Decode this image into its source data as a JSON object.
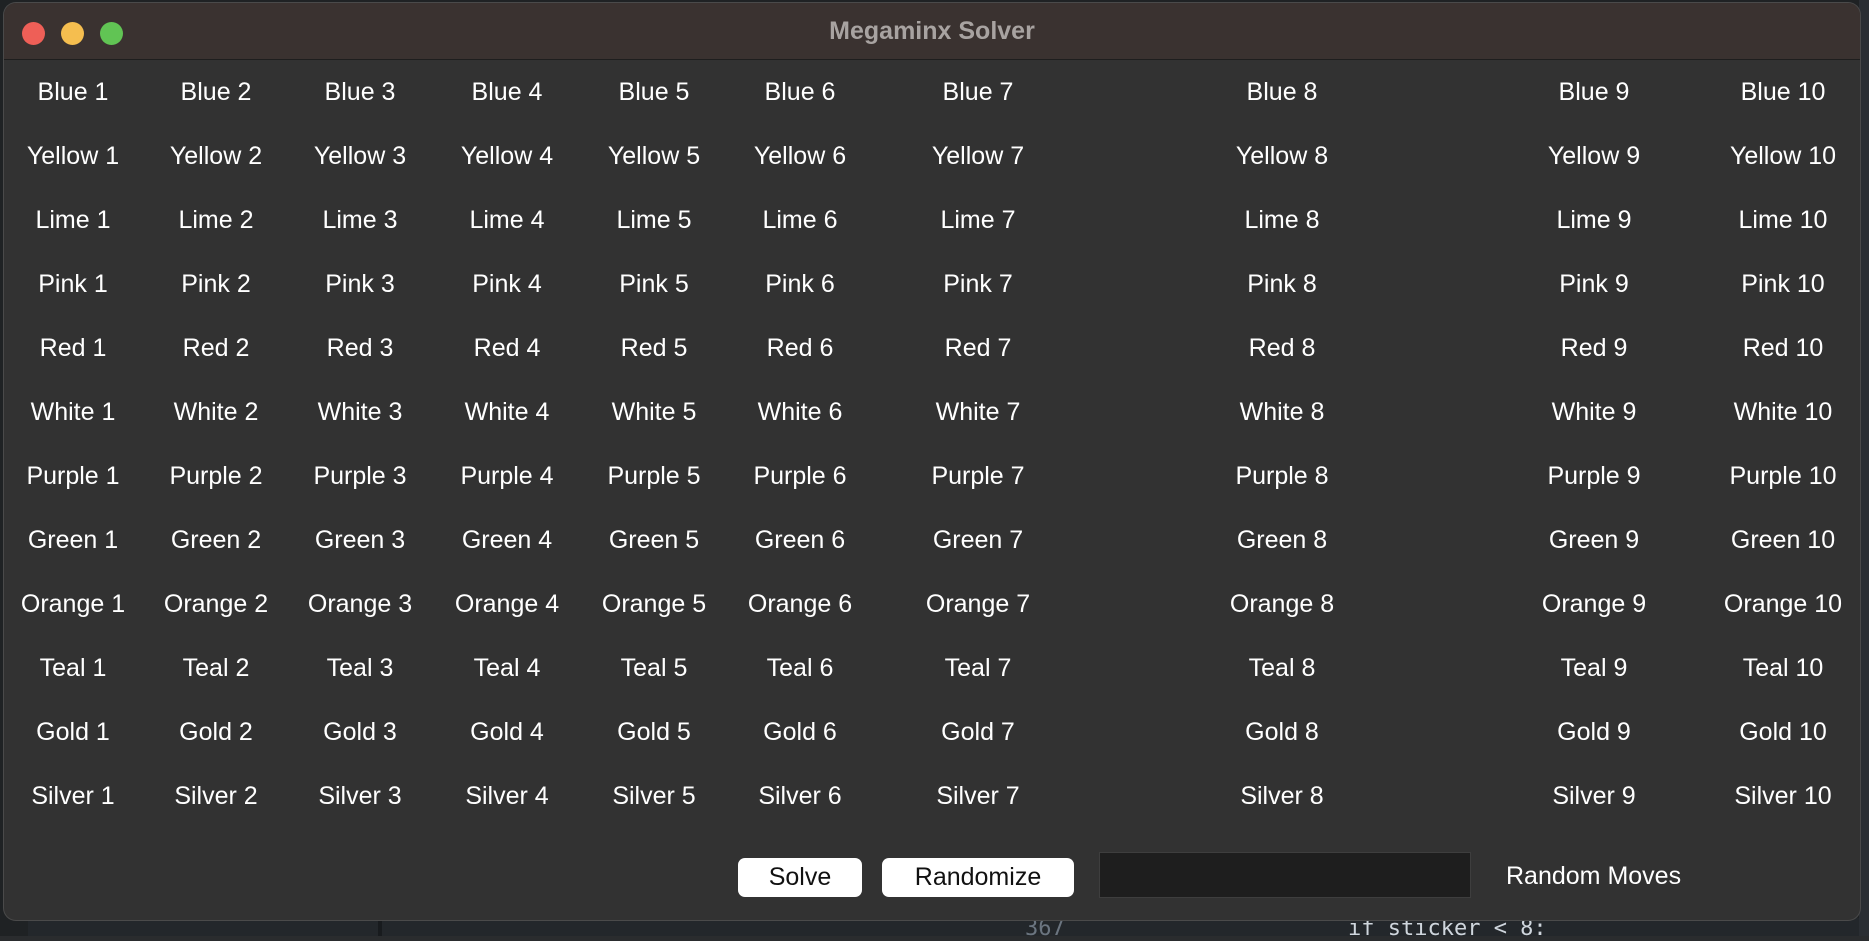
{
  "window": {
    "title": "Megaminx Solver"
  },
  "grid": {
    "rows": [
      [
        "Blue 1",
        "Blue 2",
        "Blue 3",
        "Blue 4",
        "Blue 5",
        "Blue 6",
        "Blue 7",
        "Blue 8",
        "Blue 9",
        "Blue 10"
      ],
      [
        "Yellow 1",
        "Yellow 2",
        "Yellow 3",
        "Yellow 4",
        "Yellow 5",
        "Yellow 6",
        "Yellow 7",
        "Yellow 8",
        "Yellow 9",
        "Yellow 10"
      ],
      [
        "Lime 1",
        "Lime 2",
        "Lime 3",
        "Lime 4",
        "Lime 5",
        "Lime 6",
        "Lime 7",
        "Lime 8",
        "Lime 9",
        "Lime 10"
      ],
      [
        "Pink 1",
        "Pink 2",
        "Pink 3",
        "Pink 4",
        "Pink 5",
        "Pink 6",
        "Pink 7",
        "Pink 8",
        "Pink 9",
        "Pink 10"
      ],
      [
        "Red 1",
        "Red 2",
        "Red 3",
        "Red 4",
        "Red 5",
        "Red 6",
        "Red 7",
        "Red 8",
        "Red 9",
        "Red 10"
      ],
      [
        "White 1",
        "White 2",
        "White 3",
        "White 4",
        "White 5",
        "White 6",
        "White 7",
        "White 8",
        "White 9",
        "White 10"
      ],
      [
        "Purple 1",
        "Purple 2",
        "Purple 3",
        "Purple 4",
        "Purple 5",
        "Purple 6",
        "Purple 7",
        "Purple 8",
        "Purple 9",
        "Purple 10"
      ],
      [
        "Green 1",
        "Green 2",
        "Green 3",
        "Green 4",
        "Green 5",
        "Green 6",
        "Green 7",
        "Green 8",
        "Green 9",
        "Green 10"
      ],
      [
        "Orange 1",
        "Orange 2",
        "Orange 3",
        "Orange 4",
        "Orange 5",
        "Orange 6",
        "Orange 7",
        "Orange 8",
        "Orange 9",
        "Orange 10"
      ],
      [
        "Teal 1",
        "Teal 2",
        "Teal 3",
        "Teal 4",
        "Teal 5",
        "Teal 6",
        "Teal 7",
        "Teal 8",
        "Teal 9",
        "Teal 10"
      ],
      [
        "Gold 1",
        "Gold 2",
        "Gold 3",
        "Gold 4",
        "Gold 5",
        "Gold 6",
        "Gold 7",
        "Gold 8",
        "Gold 9",
        "Gold 10"
      ],
      [
        "Silver 1",
        "Silver 2",
        "Silver 3",
        "Silver 4",
        "Silver 5",
        "Silver 6",
        "Silver 7",
        "Silver 8",
        "Silver 9",
        "Silver 10"
      ]
    ]
  },
  "controls": {
    "solve_label": "Solve",
    "randomize_label": "Randomize",
    "random_moves_value": "",
    "random_moves_label": "Random Moves"
  },
  "background_editor": {
    "line_number": "367",
    "code_text": "if sticker < 8:"
  },
  "colors": {
    "window_bg": "#323232",
    "titlebar_bg": "#3a3230",
    "close": "#ee5f57",
    "minimize": "#f5be4f",
    "maximize": "#61c454"
  }
}
